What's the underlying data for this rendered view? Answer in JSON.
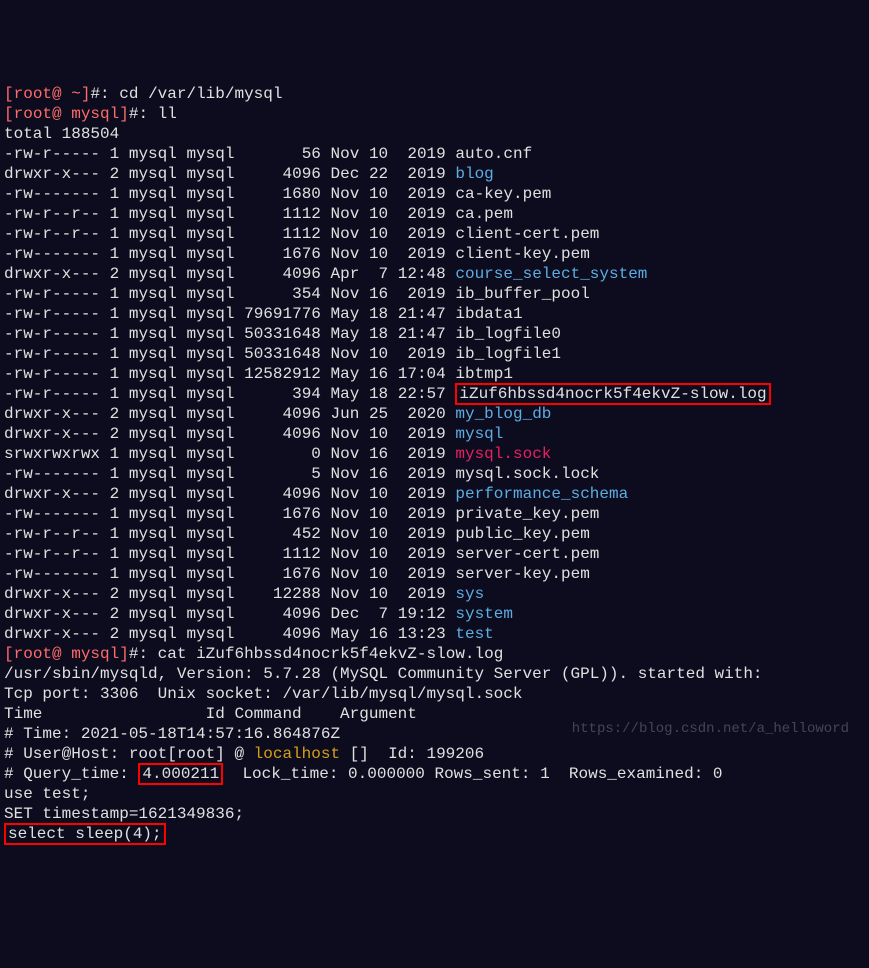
{
  "prompt1": {
    "open": "[",
    "user": "root@",
    "path": " ~",
    "close": "]",
    "hash": "#",
    "colon": ":",
    "cmd": " cd /var/lib/mysql"
  },
  "prompt2": {
    "open": "[",
    "user": "root@",
    "path": " mysql",
    "close": "]",
    "hash": "#",
    "colon": ":",
    "cmd": " ll"
  },
  "total": "total 188504",
  "files": [
    {
      "perm": "-rw-r-----",
      "links": "1",
      "owner": "mysql",
      "group": "mysql",
      "size": "      56",
      "month": "Nov",
      "day": "10",
      "time": " 2019",
      "name": "auto.cnf",
      "color": "white"
    },
    {
      "perm": "drwxr-x---",
      "links": "2",
      "owner": "mysql",
      "group": "mysql",
      "size": "    4096",
      "month": "Dec",
      "day": "22",
      "time": " 2019",
      "name": "blog",
      "color": "cyan"
    },
    {
      "perm": "-rw-------",
      "links": "1",
      "owner": "mysql",
      "group": "mysql",
      "size": "    1680",
      "month": "Nov",
      "day": "10",
      "time": " 2019",
      "name": "ca-key.pem",
      "color": "white"
    },
    {
      "perm": "-rw-r--r--",
      "links": "1",
      "owner": "mysql",
      "group": "mysql",
      "size": "    1112",
      "month": "Nov",
      "day": "10",
      "time": " 2019",
      "name": "ca.pem",
      "color": "white"
    },
    {
      "perm": "-rw-r--r--",
      "links": "1",
      "owner": "mysql",
      "group": "mysql",
      "size": "    1112",
      "month": "Nov",
      "day": "10",
      "time": " 2019",
      "name": "client-cert.pem",
      "color": "white"
    },
    {
      "perm": "-rw-------",
      "links": "1",
      "owner": "mysql",
      "group": "mysql",
      "size": "    1676",
      "month": "Nov",
      "day": "10",
      "time": " 2019",
      "name": "client-key.pem",
      "color": "white"
    },
    {
      "perm": "drwxr-x---",
      "links": "2",
      "owner": "mysql",
      "group": "mysql",
      "size": "    4096",
      "month": "Apr",
      "day": " 7",
      "time": "12:48",
      "name": "course_select_system",
      "color": "cyan"
    },
    {
      "perm": "-rw-r-----",
      "links": "1",
      "owner": "mysql",
      "group": "mysql",
      "size": "     354",
      "month": "Nov",
      "day": "16",
      "time": " 2019",
      "name": "ib_buffer_pool",
      "color": "white"
    },
    {
      "perm": "-rw-r-----",
      "links": "1",
      "owner": "mysql",
      "group": "mysql",
      "size": "79691776",
      "month": "May",
      "day": "18",
      "time": "21:47",
      "name": "ibdata1",
      "color": "white"
    },
    {
      "perm": "-rw-r-----",
      "links": "1",
      "owner": "mysql",
      "group": "mysql",
      "size": "50331648",
      "month": "May",
      "day": "18",
      "time": "21:47",
      "name": "ib_logfile0",
      "color": "white"
    },
    {
      "perm": "-rw-r-----",
      "links": "1",
      "owner": "mysql",
      "group": "mysql",
      "size": "50331648",
      "month": "Nov",
      "day": "10",
      "time": " 2019",
      "name": "ib_logfile1",
      "color": "white"
    },
    {
      "perm": "-rw-r-----",
      "links": "1",
      "owner": "mysql",
      "group": "mysql",
      "size": "12582912",
      "month": "May",
      "day": "16",
      "time": "17:04",
      "name": "ibtmp1",
      "color": "white"
    },
    {
      "perm": "-rw-r-----",
      "links": "1",
      "owner": "mysql",
      "group": "mysql",
      "size": "     394",
      "month": "May",
      "day": "18",
      "time": "22:57",
      "name": "iZuf6hbssd4nocrk5f4ekvZ-slow.log",
      "color": "white",
      "boxed": true
    },
    {
      "perm": "drwxr-x---",
      "links": "2",
      "owner": "mysql",
      "group": "mysql",
      "size": "    4096",
      "month": "Jun",
      "day": "25",
      "time": " 2020",
      "name": "my_blog_db",
      "color": "cyan"
    },
    {
      "perm": "drwxr-x---",
      "links": "2",
      "owner": "mysql",
      "group": "mysql",
      "size": "    4096",
      "month": "Nov",
      "day": "10",
      "time": " 2019",
      "name": "mysql",
      "color": "cyan"
    },
    {
      "perm": "srwxrwxrwx",
      "links": "1",
      "owner": "mysql",
      "group": "mysql",
      "size": "       0",
      "month": "Nov",
      "day": "16",
      "time": " 2019",
      "name": "mysql.sock",
      "color": "magenta"
    },
    {
      "perm": "-rw-------",
      "links": "1",
      "owner": "mysql",
      "group": "mysql",
      "size": "       5",
      "month": "Nov",
      "day": "16",
      "time": " 2019",
      "name": "mysql.sock.lock",
      "color": "white"
    },
    {
      "perm": "drwxr-x---",
      "links": "2",
      "owner": "mysql",
      "group": "mysql",
      "size": "    4096",
      "month": "Nov",
      "day": "10",
      "time": " 2019",
      "name": "performance_schema",
      "color": "cyan"
    },
    {
      "perm": "-rw-------",
      "links": "1",
      "owner": "mysql",
      "group": "mysql",
      "size": "    1676",
      "month": "Nov",
      "day": "10",
      "time": " 2019",
      "name": "private_key.pem",
      "color": "white"
    },
    {
      "perm": "-rw-r--r--",
      "links": "1",
      "owner": "mysql",
      "group": "mysql",
      "size": "     452",
      "month": "Nov",
      "day": "10",
      "time": " 2019",
      "name": "public_key.pem",
      "color": "white"
    },
    {
      "perm": "-rw-r--r--",
      "links": "1",
      "owner": "mysql",
      "group": "mysql",
      "size": "    1112",
      "month": "Nov",
      "day": "10",
      "time": " 2019",
      "name": "server-cert.pem",
      "color": "white"
    },
    {
      "perm": "-rw-------",
      "links": "1",
      "owner": "mysql",
      "group": "mysql",
      "size": "    1676",
      "month": "Nov",
      "day": "10",
      "time": " 2019",
      "name": "server-key.pem",
      "color": "white"
    },
    {
      "perm": "drwxr-x---",
      "links": "2",
      "owner": "mysql",
      "group": "mysql",
      "size": "   12288",
      "month": "Nov",
      "day": "10",
      "time": " 2019",
      "name": "sys",
      "color": "cyan"
    },
    {
      "perm": "drwxr-x---",
      "links": "2",
      "owner": "mysql",
      "group": "mysql",
      "size": "    4096",
      "month": "Dec",
      "day": " 7",
      "time": "19:12",
      "name": "system",
      "color": "cyan"
    },
    {
      "perm": "drwxr-x---",
      "links": "2",
      "owner": "mysql",
      "group": "mysql",
      "size": "    4096",
      "month": "May",
      "day": "16",
      "time": "13:23",
      "name": "test",
      "color": "cyan"
    }
  ],
  "prompt3": {
    "open": "[",
    "user": "root@",
    "path": " mysql",
    "close": "]",
    "hash": "#",
    "colon": ":",
    "cmd": " cat iZuf6hbssd4nocrk5f4ekvZ-slow.log"
  },
  "slowlog": {
    "l1": "/usr/sbin/mysqld, Version: 5.7.28 (MySQL Community Server (GPL)). started with:",
    "l2": "Tcp port: 3306  Unix socket: /var/lib/mysql/mysql.sock",
    "l3": "Time                 Id Command    Argument",
    "l4": "# Time: 2021-05-18T14:57:16.864876Z",
    "l5_pre": "# User@Host: root[root] @ ",
    "l5_host": "localhost",
    "l5_post": " []  Id: 199206",
    "l6_pre": "# Query_time: ",
    "l6_val": "4.000211",
    "l6_post": "  Lock_time: 0.000000 Rows_sent: 1  Rows_examined: 0",
    "l7": "use test;",
    "l8": "SET timestamp=1621349836;",
    "l9": "select sleep(4);"
  },
  "watermark": "https://blog.csdn.net/a_helloword"
}
